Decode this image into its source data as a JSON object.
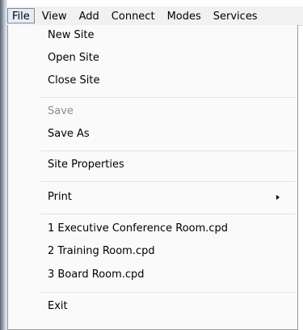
{
  "menubar": {
    "items": [
      {
        "label": "File"
      },
      {
        "label": "View"
      },
      {
        "label": "Add"
      },
      {
        "label": "Connect"
      },
      {
        "label": "Modes"
      },
      {
        "label": "Services"
      }
    ]
  },
  "file_menu": {
    "new_site": "New Site",
    "open_site": "Open Site",
    "close_site": "Close Site",
    "save": "Save",
    "save_as": "Save As",
    "site_properties": "Site Properties",
    "print": "Print",
    "recent_1": "1  Executive Conference Room.cpd",
    "recent_2": "2  Training Room.cpd",
    "recent_3": "3  Board Room.cpd",
    "exit": "Exit"
  },
  "state": {
    "open_menu": "File",
    "disabled_items": [
      "Save"
    ]
  },
  "icons": {
    "print_submenu": "submenu-arrow-icon"
  }
}
